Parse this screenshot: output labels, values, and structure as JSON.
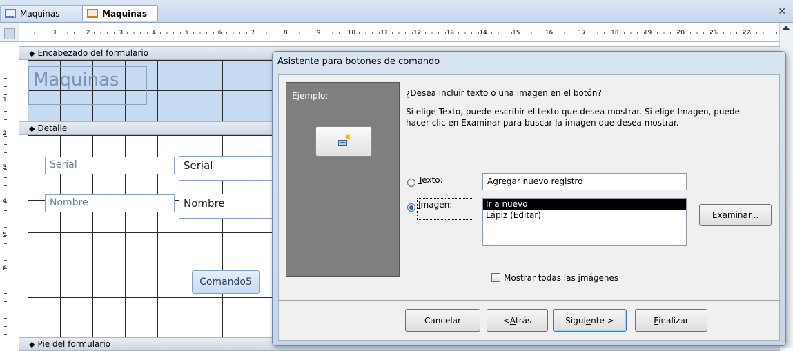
{
  "tabs": [
    {
      "label": "Maquinas",
      "icon": "table-icon"
    },
    {
      "label": "Maquinas",
      "icon": "form-icon"
    }
  ],
  "ruler": {
    "h_numbers": [
      "1",
      "2",
      "3",
      "4",
      "5",
      "6",
      "7",
      "8",
      "9",
      "10",
      "11",
      "12",
      "13",
      "14",
      "15",
      "16",
      "17",
      "18",
      "19",
      "20",
      "21",
      "22"
    ],
    "v_numbers": [
      "1",
      "2",
      "3",
      "4",
      "5",
      "6"
    ]
  },
  "sections": {
    "header": "Encabezado del formulario",
    "detail": "Detalle",
    "footer": "Pie del formulario"
  },
  "form": {
    "title": "Maquinas",
    "serial_label": "Serial",
    "serial_field": "Serial",
    "nombre_label": "Nombre",
    "nombre_field": "Nombre",
    "command_button": "Comando5"
  },
  "wizard": {
    "title": "Asistente para botones de comando",
    "sample_label": "Ejemplo:",
    "question": "¿Desea incluir texto o una imagen en el botón?",
    "explanation": "Si elige Texto, puede escribir el texto que desea mostrar. Si elige Imagen, puede hacer clic en Examinar para buscar la imagen que desea mostrar.",
    "text_option": {
      "pre": "",
      "key": "T",
      "post": "exto:"
    },
    "image_option": {
      "pre": "",
      "key": "I",
      "post": "magen:"
    },
    "text_value": "Agregar nuevo registro",
    "image_list": [
      "Ir a nuevo",
      "Lápiz (Editar)"
    ],
    "selected_option": "image",
    "browse_button": {
      "pre": "E",
      "key": "x",
      "post": "aminar..."
    },
    "show_all": {
      "pre": "Mostrar todas las ",
      "key": "i",
      "post": "mágenes"
    },
    "show_all_checked": false,
    "buttons": {
      "cancel": "Cancelar",
      "back": {
        "pre": "< ",
        "key": "A",
        "post": "trás"
      },
      "next": {
        "pre": "Sigui",
        "key": "e",
        "post": "nte >"
      },
      "finish": {
        "pre": "",
        "key": "F",
        "post": "inalizar"
      }
    }
  },
  "colors": {
    "header_fill": "#c6daf2",
    "selection": "#000000",
    "sample_panel": "#7f7f7f"
  }
}
